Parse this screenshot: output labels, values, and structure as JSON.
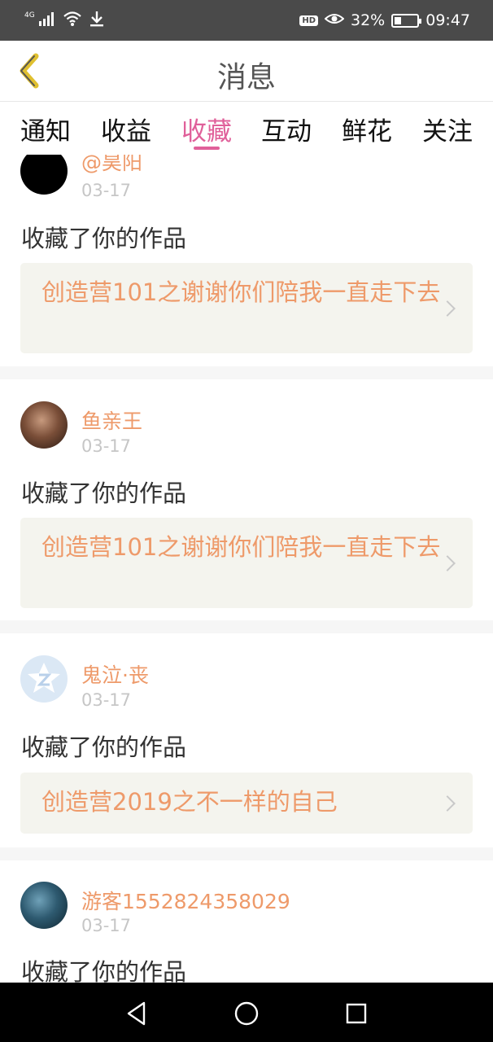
{
  "status_bar": {
    "network": "4G",
    "battery_percent": "32%",
    "time": "09:47",
    "hd_label": "HD",
    "battery_level": 0.32,
    "icons": [
      "signal-icon",
      "wifi-icon",
      "download-icon",
      "hd-icon",
      "eye-icon",
      "battery-icon"
    ]
  },
  "header": {
    "title": "消息",
    "back_icon": "chevron-left-icon",
    "accent_color": "#e0c030"
  },
  "tabs": [
    {
      "label": "通知",
      "active": false
    },
    {
      "label": "收益",
      "active": false
    },
    {
      "label": "收藏",
      "active": true
    },
    {
      "label": "互动",
      "active": false
    },
    {
      "label": "鲜花",
      "active": false
    },
    {
      "label": "关注",
      "active": false
    }
  ],
  "colors": {
    "active_tab": "#e0609a",
    "username": "#ee9a6a",
    "work_title": "#ee9a6a",
    "time": "#c6c6c6",
    "card_box": "#f4f4ee"
  },
  "items": [
    {
      "username": "@昊阳",
      "time": "03-17",
      "action": "收藏了你的作品",
      "work_title": "创造营101之谢谢你们陪我一直走下去"
    },
    {
      "username": "鱼亲王",
      "time": "03-17",
      "action": "收藏了你的作品",
      "work_title": "创造营101之谢谢你们陪我一直走下去"
    },
    {
      "username": "鬼泣·丧",
      "time": "03-17",
      "action": "收藏了你的作品",
      "work_title": "创造营2019之不一样的自己"
    },
    {
      "username": "游客1552824358029",
      "time": "03-17",
      "action": "收藏了你的作品"
    }
  ],
  "nav_bar": {
    "icons": [
      "back-triangle-icon",
      "home-circle-icon",
      "recents-square-icon"
    ]
  }
}
